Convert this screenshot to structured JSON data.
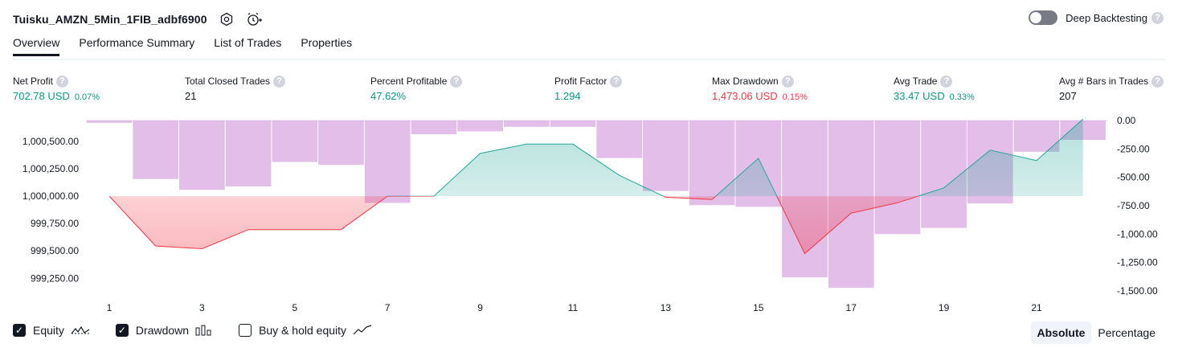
{
  "header": {
    "title": "Tuisku_AMZN_5Min_1FIB_adbf6900",
    "icons": [
      "settings-icon",
      "add-alert-icon"
    ]
  },
  "deep_backtesting": {
    "label": "Deep Backtesting",
    "enabled": false,
    "help": "?"
  },
  "tabs": [
    {
      "label": "Overview",
      "active": true
    },
    {
      "label": "Performance Summary",
      "active": false
    },
    {
      "label": "List of Trades",
      "active": false
    },
    {
      "label": "Properties",
      "active": false
    }
  ],
  "help_glyph": "?",
  "metrics": [
    {
      "label": "Net Profit",
      "value": "702.78 USD",
      "pct": "0.07%",
      "color": "#089981"
    },
    {
      "label": "Total Closed Trades",
      "value": "21",
      "pct": "",
      "color": "#131722"
    },
    {
      "label": "Percent Profitable",
      "value": "47.62%",
      "pct": "",
      "color": "#089981"
    },
    {
      "label": "Profit Factor",
      "value": "1.294",
      "pct": "",
      "color": "#089981"
    },
    {
      "label": "Max Drawdown",
      "value": "1,473.06 USD",
      "pct": "0.15%",
      "color": "#f23645"
    },
    {
      "label": "Avg Trade",
      "value": "33.47 USD",
      "pct": "0.33%",
      "color": "#089981"
    },
    {
      "label": "Avg # Bars in Trades",
      "value": "207",
      "pct": "",
      "color": "#131722"
    }
  ],
  "chart_data": {
    "type": "line",
    "x": [
      1,
      2,
      3,
      4,
      5,
      6,
      7,
      8,
      9,
      10,
      11,
      12,
      13,
      14,
      15,
      16,
      17,
      18,
      19,
      20,
      21,
      22
    ],
    "series": [
      {
        "values": [
          1000000,
          999545,
          999520,
          999695,
          999695,
          999695,
          1000000,
          1000000,
          1000390,
          1000475,
          1000475,
          1000190,
          999990,
          999970,
          1000345,
          999475,
          999845,
          999940,
          1000075,
          1000420,
          1000325,
          1000703
        ]
      },
      {
        "values": [
          -20,
          -515,
          -610,
          -580,
          -365,
          -390,
          -725,
          -120,
          -95,
          -55,
          -55,
          -330,
          -620,
          -745,
          -760,
          -1380,
          -1473,
          -1000,
          -945,
          -730,
          -275,
          -170
        ]
      }
    ],
    "left_axis": {
      "ticks": [
        "1,000,500.00",
        "1,000,250.00",
        "1,000,000.00",
        "999,750.00",
        "999,500.00",
        "999,250.00"
      ],
      "values": [
        1000500,
        1000250,
        1000000,
        999750,
        999500,
        999250
      ],
      "range": [
        999135,
        1000690
      ]
    },
    "right_axis": {
      "ticks": [
        "0.00",
        "-250.00",
        "-500.00",
        "-750.00",
        "-1,000.00",
        "-1,250.00",
        "-1,500.00"
      ],
      "values": [
        0,
        -250,
        -500,
        -750,
        -1000,
        -1250,
        -1500
      ],
      "range": [
        -1500,
        0
      ]
    },
    "x_ticks": [
      "1",
      "3",
      "5",
      "7",
      "9",
      "11",
      "13",
      "15",
      "17",
      "19",
      "21"
    ],
    "baseline": 1000000,
    "colors": {
      "positive": "#26a69a",
      "negative": "#f23645",
      "bars": "#ce93d8"
    }
  },
  "legend": [
    {
      "label": "Equity",
      "checked": true,
      "icon": "equity-line-icon"
    },
    {
      "label": "Drawdown",
      "checked": true,
      "icon": "drawdown-bars-icon"
    },
    {
      "label": "Buy & hold equity",
      "checked": false,
      "icon": "buy-hold-line-icon"
    }
  ],
  "checkbox_glyph": "✓",
  "view_mode": {
    "options": [
      "Absolute",
      "Percentage"
    ],
    "active": "Absolute"
  }
}
